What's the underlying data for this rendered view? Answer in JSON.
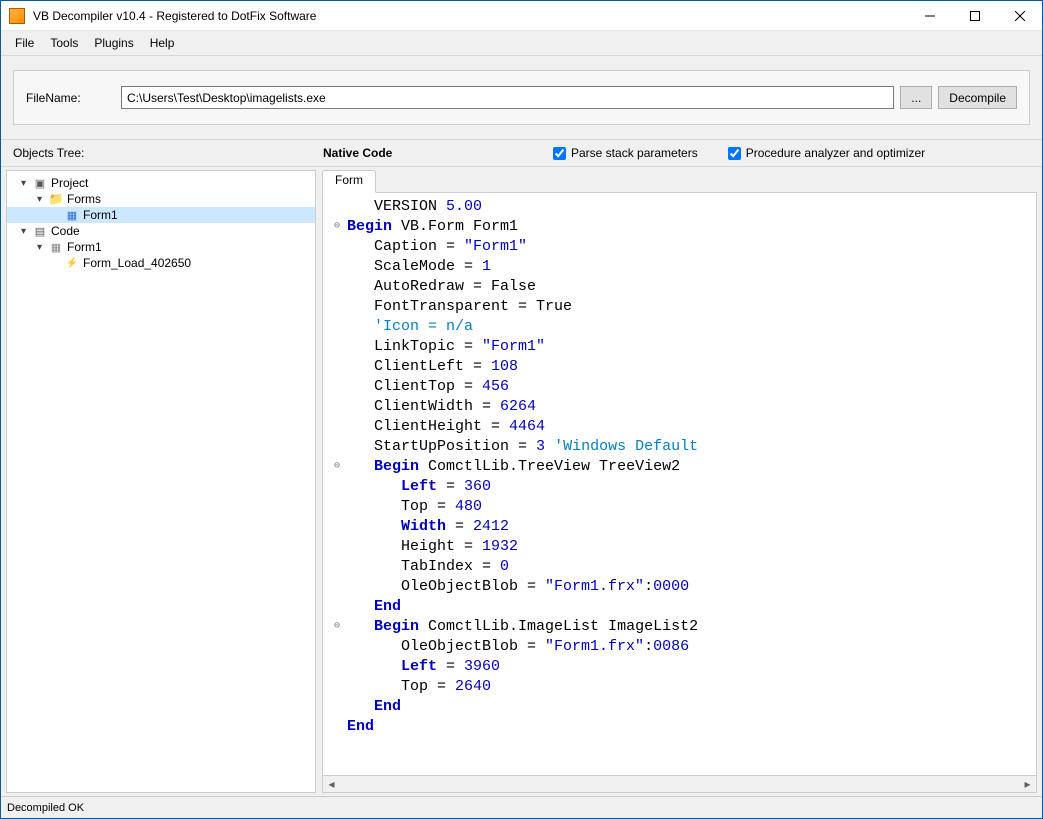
{
  "titlebar": {
    "title": "VB Decompiler v10.4 - Registered to DotFix Software"
  },
  "menu": {
    "file": "File",
    "tools": "Tools",
    "plugins": "Plugins",
    "help": "Help"
  },
  "filerow": {
    "label": "FileName:",
    "path": "C:\\Users\\Test\\Desktop\\imagelists.exe",
    "browse": "...",
    "decompile": "Decompile"
  },
  "header": {
    "objtree": "Objects Tree:",
    "nativecode": "Native Code",
    "cb1": "Parse stack parameters",
    "cb2": "Procedure analyzer and optimizer"
  },
  "tree": {
    "project": "Project",
    "forms": "Forms",
    "form1": "Form1",
    "code": "Code",
    "codeform1": "Form1",
    "formload": "Form_Load_402650"
  },
  "tab": {
    "form": "Form"
  },
  "code": [
    {
      "g": "",
      "spans": [
        [
          "txt",
          "   VERSION "
        ],
        [
          "num",
          "5.00"
        ]
      ]
    },
    {
      "g": "⊖",
      "spans": [
        [
          "kw",
          "Begin"
        ],
        [
          "txt",
          " VB.Form Form1"
        ]
      ]
    },
    {
      "g": "",
      "spans": [
        [
          "txt",
          "   Caption = "
        ],
        [
          "str",
          "\"Form1\""
        ]
      ]
    },
    {
      "g": "",
      "spans": [
        [
          "txt",
          "   ScaleMode = "
        ],
        [
          "num",
          "1"
        ]
      ]
    },
    {
      "g": "",
      "spans": [
        [
          "txt",
          "   AutoRedraw = False"
        ]
      ]
    },
    {
      "g": "",
      "spans": [
        [
          "txt",
          "   FontTransparent = True"
        ]
      ]
    },
    {
      "g": "",
      "spans": [
        [
          "txt",
          "   "
        ],
        [
          "cmt",
          "'Icon = n/a"
        ]
      ]
    },
    {
      "g": "",
      "spans": [
        [
          "txt",
          "   LinkTopic = "
        ],
        [
          "str",
          "\"Form1\""
        ]
      ]
    },
    {
      "g": "",
      "spans": [
        [
          "txt",
          "   ClientLeft = "
        ],
        [
          "num",
          "108"
        ]
      ]
    },
    {
      "g": "",
      "spans": [
        [
          "txt",
          "   ClientTop = "
        ],
        [
          "num",
          "456"
        ]
      ]
    },
    {
      "g": "",
      "spans": [
        [
          "txt",
          "   ClientWidth = "
        ],
        [
          "num",
          "6264"
        ]
      ]
    },
    {
      "g": "",
      "spans": [
        [
          "txt",
          "   ClientHeight = "
        ],
        [
          "num",
          "4464"
        ]
      ]
    },
    {
      "g": "",
      "spans": [
        [
          "txt",
          "   StartUpPosition = "
        ],
        [
          "num",
          "3"
        ],
        [
          "txt",
          " "
        ],
        [
          "cmt",
          "'Windows Default"
        ]
      ]
    },
    {
      "g": "⊖",
      "spans": [
        [
          "txt",
          "   "
        ],
        [
          "kw",
          "Begin"
        ],
        [
          "txt",
          " ComctlLib.TreeView TreeView2"
        ]
      ]
    },
    {
      "g": "",
      "spans": [
        [
          "txt",
          "      "
        ],
        [
          "kw",
          "Left"
        ],
        [
          "txt",
          " = "
        ],
        [
          "num",
          "360"
        ]
      ]
    },
    {
      "g": "",
      "spans": [
        [
          "txt",
          "      Top = "
        ],
        [
          "num",
          "480"
        ]
      ]
    },
    {
      "g": "",
      "spans": [
        [
          "txt",
          "      "
        ],
        [
          "kw",
          "Width"
        ],
        [
          "txt",
          " = "
        ],
        [
          "num",
          "2412"
        ]
      ]
    },
    {
      "g": "",
      "spans": [
        [
          "txt",
          "      Height = "
        ],
        [
          "num",
          "1932"
        ]
      ]
    },
    {
      "g": "",
      "spans": [
        [
          "txt",
          "      TabIndex = "
        ],
        [
          "num",
          "0"
        ]
      ]
    },
    {
      "g": "",
      "spans": [
        [
          "txt",
          "      OleObjectBlob = "
        ],
        [
          "str",
          "\"Form1.frx\""
        ],
        [
          "txt",
          ":"
        ],
        [
          "num",
          "0000"
        ]
      ]
    },
    {
      "g": "",
      "spans": [
        [
          "txt",
          "   "
        ],
        [
          "kw",
          "End"
        ]
      ]
    },
    {
      "g": "⊖",
      "spans": [
        [
          "txt",
          "   "
        ],
        [
          "kw",
          "Begin"
        ],
        [
          "txt",
          " ComctlLib.ImageList ImageList2"
        ]
      ]
    },
    {
      "g": "",
      "spans": [
        [
          "txt",
          "      OleObjectBlob = "
        ],
        [
          "str",
          "\"Form1.frx\""
        ],
        [
          "txt",
          ":"
        ],
        [
          "num",
          "0086"
        ]
      ]
    },
    {
      "g": "",
      "spans": [
        [
          "txt",
          "      "
        ],
        [
          "kw",
          "Left"
        ],
        [
          "txt",
          " = "
        ],
        [
          "num",
          "3960"
        ]
      ]
    },
    {
      "g": "",
      "spans": [
        [
          "txt",
          "      Top = "
        ],
        [
          "num",
          "2640"
        ]
      ]
    },
    {
      "g": "",
      "spans": [
        [
          "txt",
          "   "
        ],
        [
          "kw",
          "End"
        ]
      ]
    },
    {
      "g": "",
      "spans": [
        [
          "kw",
          "End"
        ]
      ]
    }
  ],
  "status": "Decompiled OK"
}
